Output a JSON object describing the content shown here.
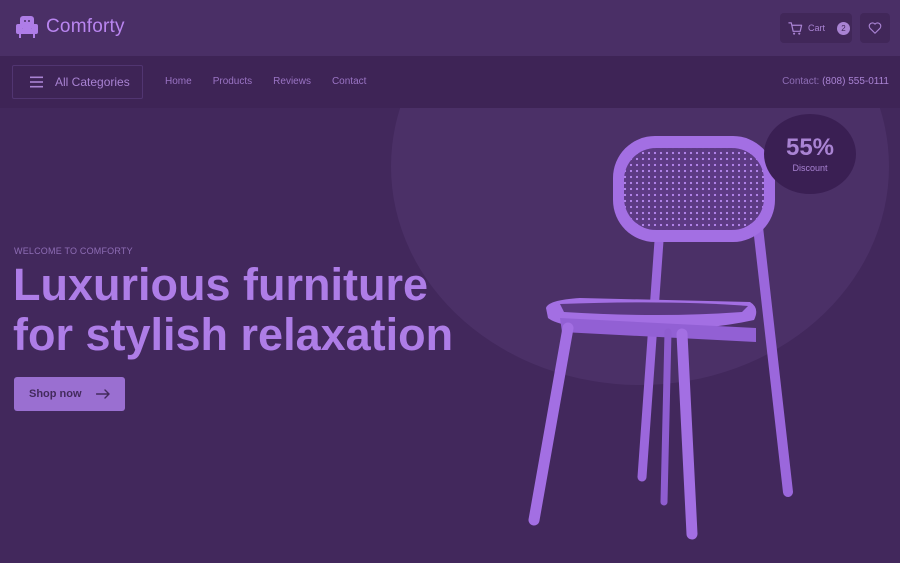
{
  "brand": {
    "name": "Comforty",
    "logo_icon": "armchair-icon"
  },
  "header": {
    "cart_label": "Cart",
    "cart_count": "2",
    "cart_icon": "cart-icon",
    "wishlist_icon": "heart-icon"
  },
  "nav": {
    "categories_label": "All Categories",
    "links": [
      "Home",
      "Products",
      "Reviews",
      "Contact"
    ],
    "contact_label": "Contact:",
    "contact_phone": "(808) 555-0111"
  },
  "hero": {
    "eyebrow": "WELCOME TO COMFORTY",
    "title_line1": "Luxurious furniture",
    "title_line2": "for stylish relaxation",
    "cta_label": "Shop now",
    "discount_value": "55%",
    "discount_label": "Discount"
  },
  "colors": {
    "background": "#42285c",
    "accent": "#ae7de7",
    "button": "#9a6fd1",
    "text_muted": "#8e6db5"
  }
}
